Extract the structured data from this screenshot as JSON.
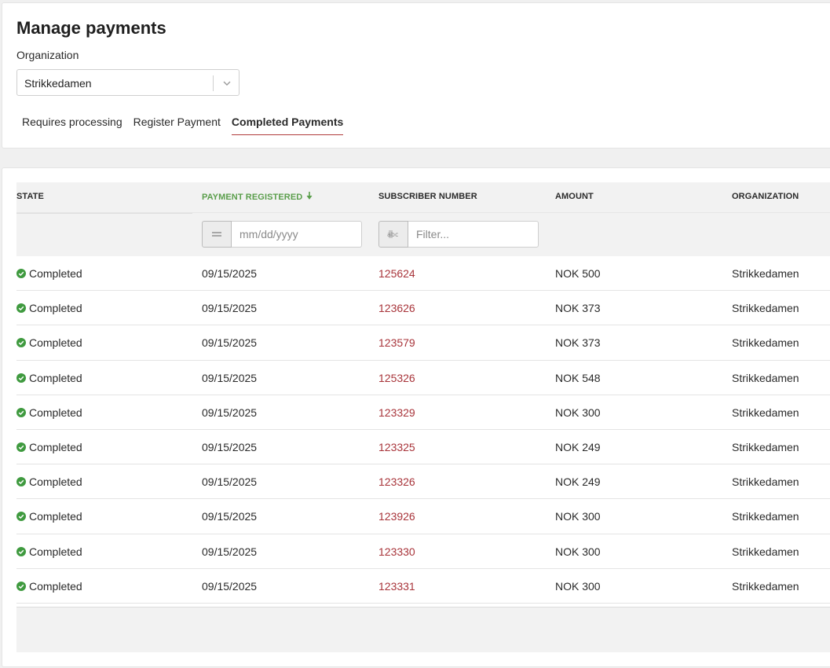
{
  "page": {
    "title": "Manage payments"
  },
  "organization": {
    "label": "Organization",
    "selected": "Strikkedamen"
  },
  "tabs": [
    {
      "label": "Requires processing",
      "active": false
    },
    {
      "label": "Register Payment",
      "active": false
    },
    {
      "label": "Completed Payments",
      "active": true
    }
  ],
  "table": {
    "columns": {
      "state": "STATE",
      "payment_registered": "PAYMENT REGISTERED",
      "subscriber_number": "SUBSCRIBER NUMBER",
      "amount": "AMOUNT",
      "organization": "ORGANIZATION"
    },
    "sorted_column": "payment_registered",
    "sort_direction": "descending",
    "filters": {
      "date_placeholder": "mm/dd/yyyy",
      "text_placeholder": "Filter..."
    },
    "rows": [
      {
        "state": "Completed",
        "date": "09/15/2025",
        "subscriber": "125624",
        "amount": "NOK 500",
        "org": "Strikkedamen"
      },
      {
        "state": "Completed",
        "date": "09/15/2025",
        "subscriber": "123626",
        "amount": "NOK 373",
        "org": "Strikkedamen"
      },
      {
        "state": "Completed",
        "date": "09/15/2025",
        "subscriber": "123579",
        "amount": "NOK 373",
        "org": "Strikkedamen"
      },
      {
        "state": "Completed",
        "date": "09/15/2025",
        "subscriber": "125326",
        "amount": "NOK 548",
        "org": "Strikkedamen"
      },
      {
        "state": "Completed",
        "date": "09/15/2025",
        "subscriber": "123329",
        "amount": "NOK 300",
        "org": "Strikkedamen"
      },
      {
        "state": "Completed",
        "date": "09/15/2025",
        "subscriber": "123325",
        "amount": "NOK 249",
        "org": "Strikkedamen"
      },
      {
        "state": "Completed",
        "date": "09/15/2025",
        "subscriber": "123326",
        "amount": "NOK 249",
        "org": "Strikkedamen"
      },
      {
        "state": "Completed",
        "date": "09/15/2025",
        "subscriber": "123926",
        "amount": "NOK 300",
        "org": "Strikkedamen"
      },
      {
        "state": "Completed",
        "date": "09/15/2025",
        "subscriber": "123330",
        "amount": "NOK 300",
        "org": "Strikkedamen"
      },
      {
        "state": "Completed",
        "date": "09/15/2025",
        "subscriber": "123331",
        "amount": "NOK 300",
        "org": "Strikkedamen"
      }
    ]
  },
  "colors": {
    "accent": "#a8343a",
    "sorted_header": "#5a9e4b",
    "status_success": "#3f9a3f"
  },
  "icons": {
    "state_icon": "check-circle-icon",
    "sort_icon": "arrow-down-icon",
    "dropdown_icon": "chevron-down-icon",
    "date_filter_op": "equals-icon",
    "text_filter_op": "text-match-icon"
  }
}
